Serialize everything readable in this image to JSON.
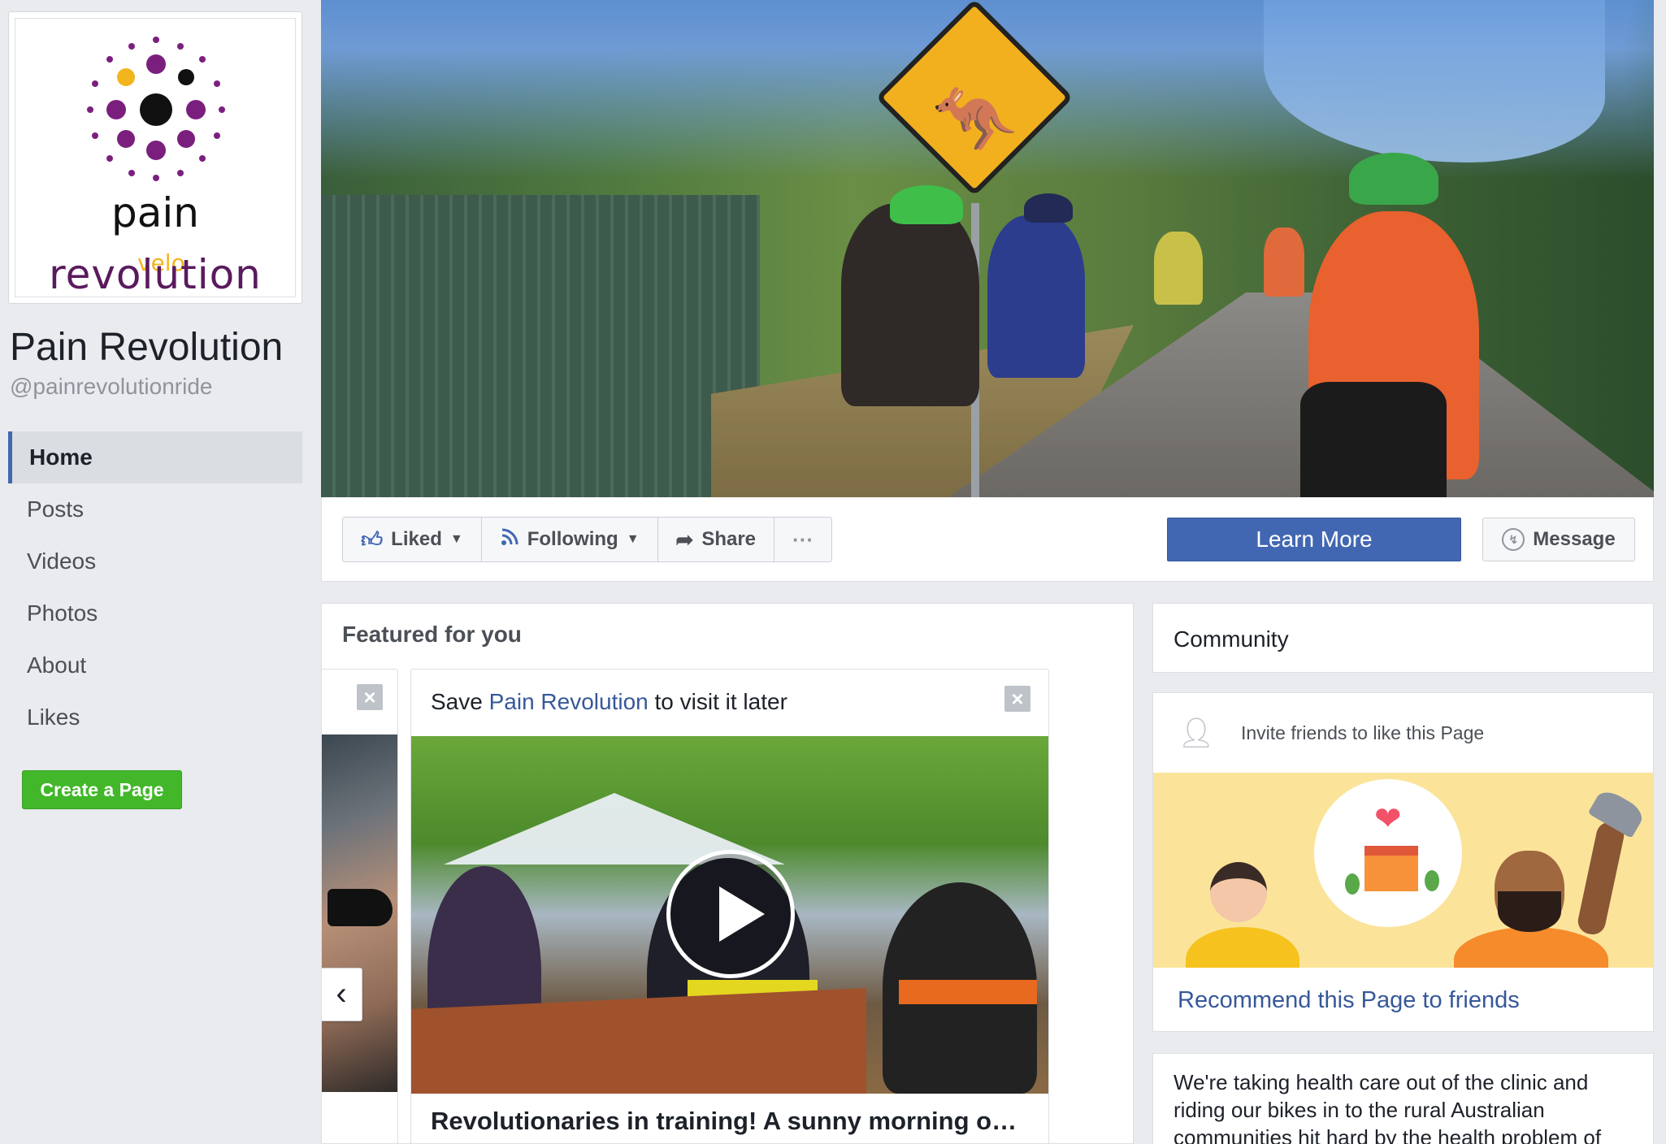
{
  "page": {
    "name": "Pain Revolution",
    "handle": "@painrevolutionride",
    "logo": {
      "word1": "pain",
      "word2": "revolution",
      "overlay": "velo",
      "brand_purple": "#5a1a5e",
      "brand_yellow": "#f3b51d"
    }
  },
  "nav": {
    "items": [
      {
        "label": "Home",
        "active": true
      },
      {
        "label": "Posts"
      },
      {
        "label": "Videos"
      },
      {
        "label": "Photos"
      },
      {
        "label": "About"
      },
      {
        "label": "Likes"
      }
    ],
    "create_page": "Create a Page"
  },
  "actions": {
    "liked": "Liked",
    "following": "Following",
    "share": "Share",
    "more": "···",
    "learn_more": "Learn More",
    "message": "Message"
  },
  "featured": {
    "title": "Featured for you",
    "save_prefix": "Save ",
    "save_link": "Pain Revolution",
    "save_suffix": " to visit it later",
    "video_title": "Revolutionaries in training! A sunny morning on ..."
  },
  "sidebar_right": {
    "community_title": "Community",
    "invite_text": "Invite friends to like this Page",
    "recommend": "Recommend this Page to friends",
    "about_text": "We're taking health care out of the clinic and riding our bikes in to the rural Australian communities hit hard by the health problem of"
  },
  "colors": {
    "facebook_blue": "#4267b2",
    "link_blue": "#365899",
    "create_green": "#42b72a",
    "background": "#e9ebee"
  },
  "icons": {
    "liked": "thumbs-up-icon",
    "following": "rss-icon",
    "share": "share-arrow-icon",
    "message": "messenger-icon",
    "invite": "add-friend-icon",
    "carousel_prev": "chevron-left-icon",
    "close": "close-icon"
  }
}
